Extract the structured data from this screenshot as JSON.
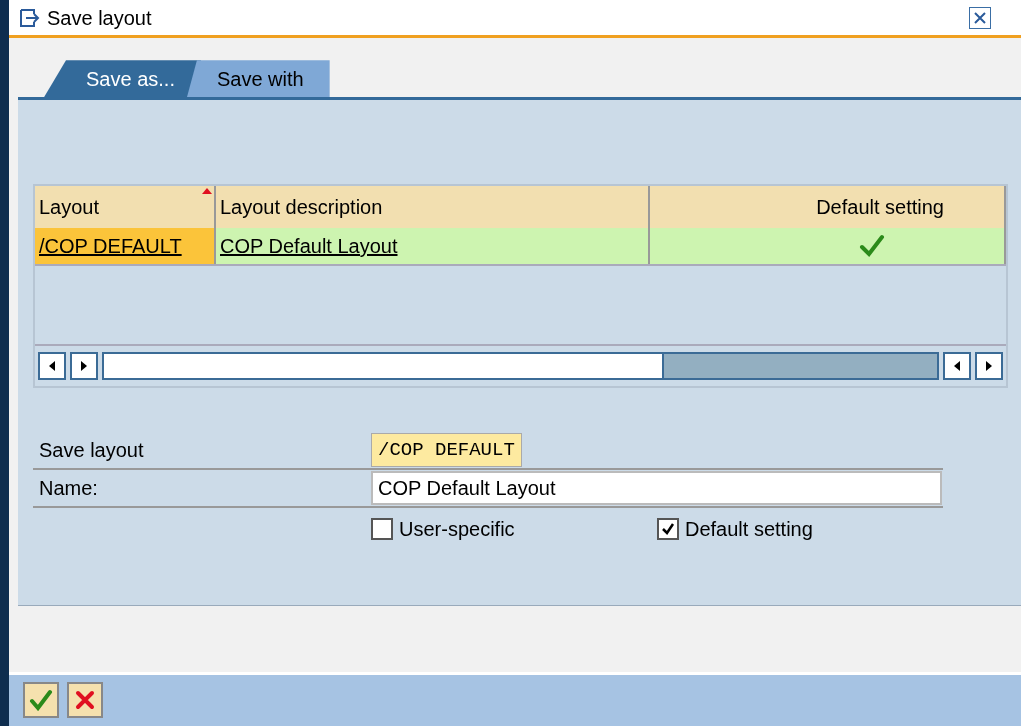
{
  "window": {
    "title": "Save layout"
  },
  "tabs": [
    {
      "label": "Save as...",
      "selected": true
    },
    {
      "label": "Save with",
      "selected": false
    }
  ],
  "table": {
    "columns": [
      "Layout",
      "Layout description",
      "Default setting"
    ],
    "rows": [
      {
        "layout": "/COP DEFAULT",
        "description": "COP Default Layout",
        "default": true,
        "selected": true
      }
    ]
  },
  "form": {
    "save_layout": {
      "label": "Save layout",
      "value": "/COP DEFAULT"
    },
    "name": {
      "label": "Name:",
      "value": "COP Default Layout"
    },
    "checkboxes": [
      {
        "label": "User-specific",
        "checked": false
      },
      {
        "label": "Default setting",
        "checked": true
      }
    ]
  }
}
